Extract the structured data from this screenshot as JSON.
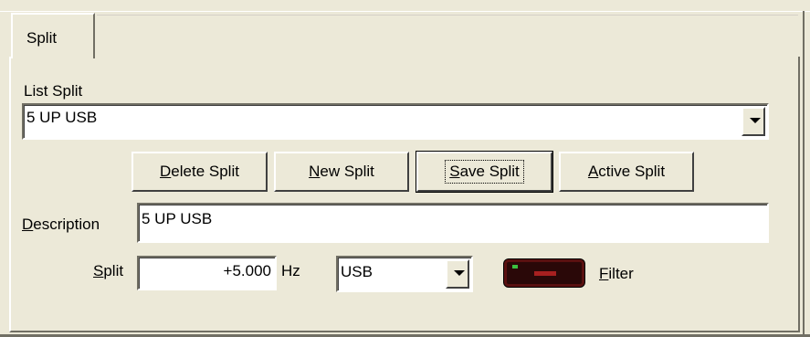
{
  "tab": {
    "label": "Split"
  },
  "list_split": {
    "label": "List Split",
    "selected": "5 UP USB"
  },
  "buttons": {
    "delete": {
      "accel": "D",
      "rest": "elete Split"
    },
    "new": {
      "accel": "N",
      "rest": "ew Split"
    },
    "save": {
      "accel": "S",
      "rest": "ave Split"
    },
    "active": {
      "accel": "A",
      "rest": "ctive Split"
    }
  },
  "description": {
    "label_accel": "D",
    "label_rest": "escription",
    "value": "5 UP USB"
  },
  "split": {
    "label_accel": "S",
    "label_rest": "plit",
    "value": "+5.000",
    "unit": "Hz"
  },
  "mode": {
    "selected": "USB"
  },
  "filter": {
    "label_accel": "F",
    "label_rest": "ilter",
    "led_color": "#a82020"
  },
  "colors": {
    "face": "#ece9d8",
    "shadow": "#716f64"
  }
}
